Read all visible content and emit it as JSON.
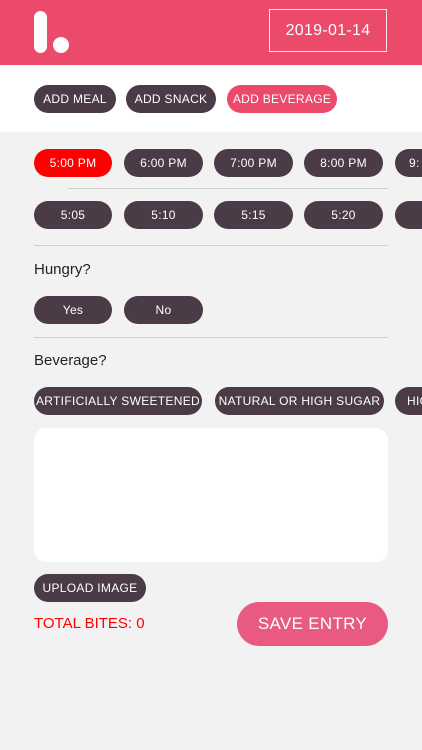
{
  "header": {
    "date": "2019-01-14"
  },
  "add_bar": {
    "meal": "ADD MEAL",
    "snack": "ADD SNACK",
    "beverage": "ADD BEVERAGE"
  },
  "hours": [
    "5:00 PM",
    "6:00 PM",
    "7:00 PM",
    "8:00 PM",
    "9:"
  ],
  "minutes": [
    "5:05",
    "5:10",
    "5:15",
    "5:20",
    ""
  ],
  "hungry": {
    "question": "Hungry?",
    "yes": "Yes",
    "no": "No"
  },
  "beverage": {
    "question": "Beverage?",
    "options": [
      "ARTIFICIALLY SWEETENED",
      "NATURAL OR HIGH SUGAR",
      "HIG"
    ]
  },
  "upload_label": "UPLOAD IMAGE",
  "total_bites": "TOTAL BITES: 0",
  "save_label": "SAVE ENTRY",
  "colors": {
    "brand": "#ec4a6a",
    "pill": "#4a3b47",
    "selected": "#ff0000",
    "save": "#e85a80"
  }
}
